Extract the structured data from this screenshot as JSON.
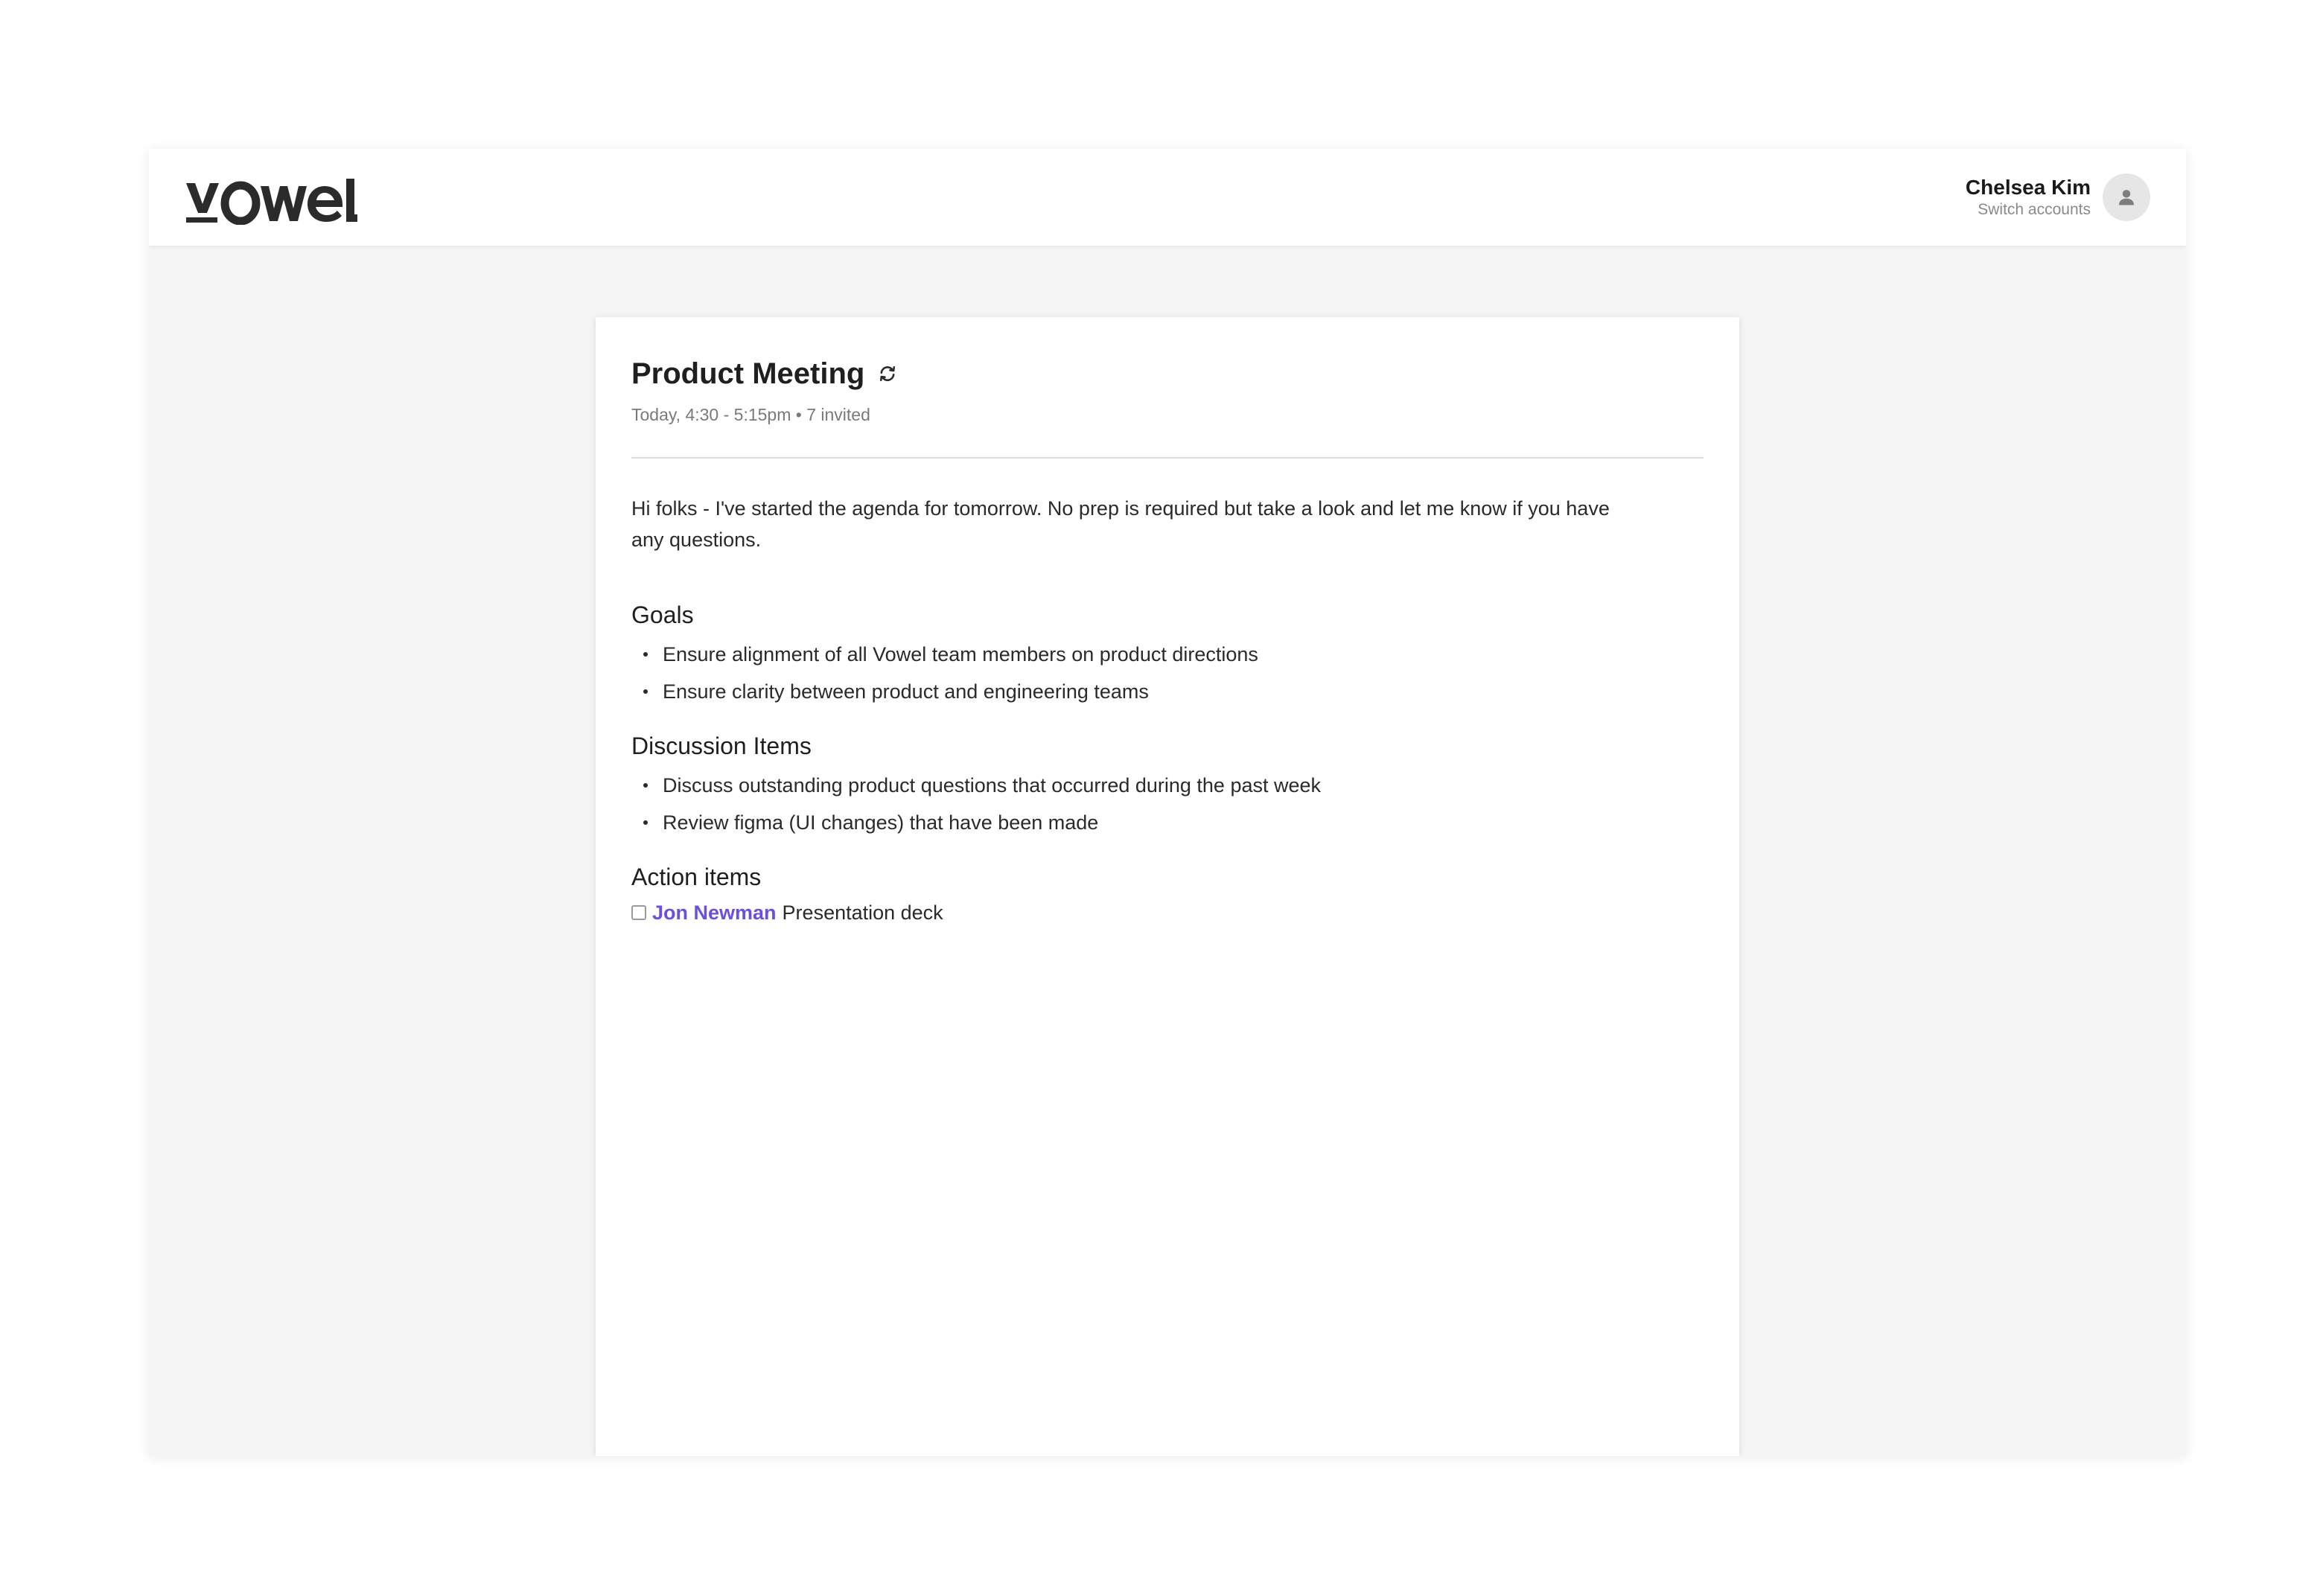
{
  "app": {
    "logo_text": "vowel",
    "brand_color": "#2b2b2b",
    "accent_color": "#6b4fe0"
  },
  "account": {
    "name": "Chelsea Kim",
    "switch_label": "Switch accounts",
    "avatar_icon": "user-icon"
  },
  "meeting": {
    "title": "Product Meeting",
    "sync_icon": "sync-icon",
    "meta": "Today, 4:30 - 5:15pm • 7 invited",
    "intro": "Hi folks - I've started the agenda for tomorrow. No prep is required but take a look and let me know if you have any questions."
  },
  "sections": {
    "goals": {
      "heading": "Goals",
      "items": [
        "Ensure alignment of all Vowel team members on product directions",
        "Ensure clarity between product and engineering teams"
      ]
    },
    "discussion": {
      "heading": "Discussion Items",
      "items": [
        "Discuss outstanding product questions that occurred during the past week",
        "Review figma (UI changes) that have been made"
      ]
    },
    "actions": {
      "heading": "Action items",
      "items": [
        {
          "checked": false,
          "assignee": "Jon Newman",
          "text": "Presentation deck"
        }
      ]
    }
  }
}
